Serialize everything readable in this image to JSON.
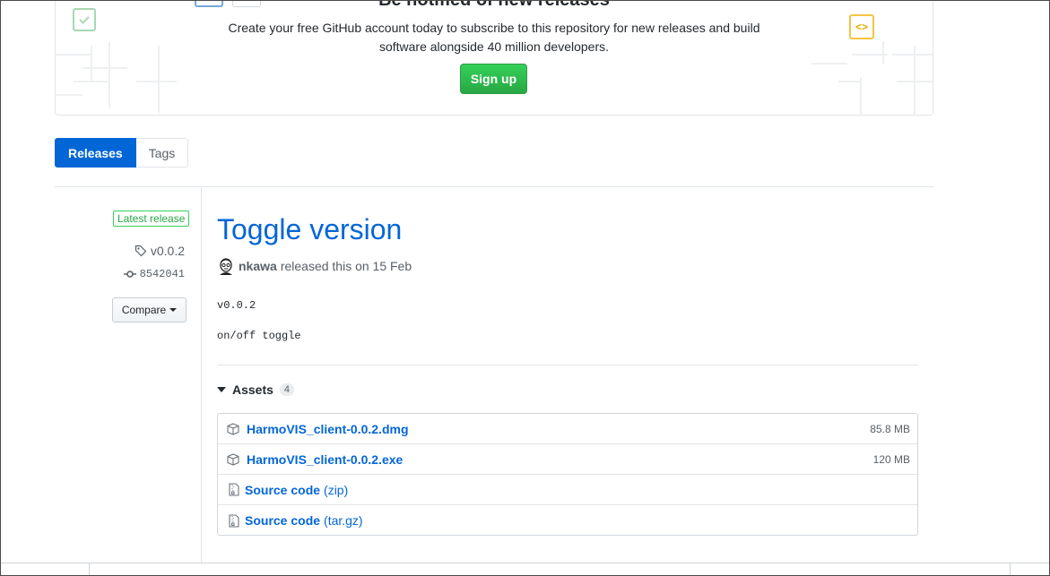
{
  "banner": {
    "title": "Be notified of new releases",
    "text": "Create your free GitHub account today to subscribe to this repository for new releases and build software alongside 40 million developers.",
    "signup_label": "Sign up",
    "code_icon_glyph": "<>"
  },
  "tabs": [
    {
      "label": "Releases",
      "active": true
    },
    {
      "label": "Tags",
      "active": false
    }
  ],
  "sidebar": {
    "latest_label": "Latest release",
    "tag": "v0.0.2",
    "commit": "8542041",
    "compare_label": "Compare"
  },
  "release": {
    "title": "Toggle version",
    "author": "nkawa",
    "released_text": "released this on 15 Feb",
    "body_line1": "v0.0.2",
    "body_line2": "on/off toggle"
  },
  "assets": {
    "label": "Assets",
    "count": "4",
    "items": [
      {
        "name": "HarmoVIS_client-0.0.2.dmg",
        "size": "85.8 MB",
        "ext": "",
        "icon": "package-icon"
      },
      {
        "name": "HarmoVIS_client-0.0.2.exe",
        "size": "120 MB",
        "ext": "",
        "icon": "package-icon"
      },
      {
        "name": "Source code",
        "size": "",
        "ext": "(zip)",
        "icon": "file-zip-icon"
      },
      {
        "name": "Source code",
        "size": "",
        "ext": "(tar.gz)",
        "icon": "file-zip-icon"
      }
    ]
  },
  "colors": {
    "link": "#0366d6",
    "signup_green": "#28a745",
    "tab_active": "#0366d6"
  }
}
